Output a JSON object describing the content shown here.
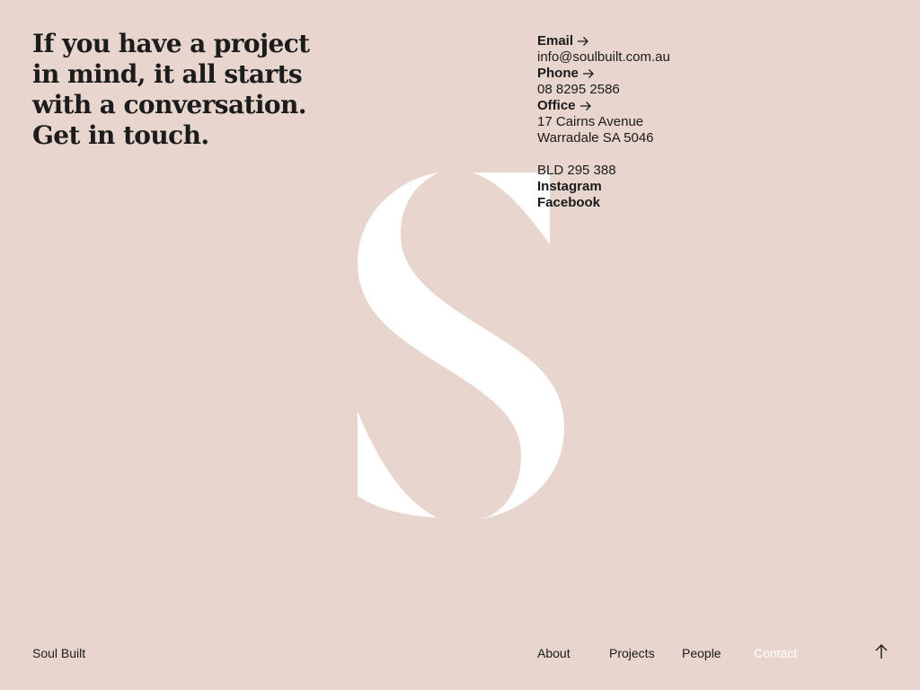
{
  "headline": "If you have a project in mind, it all starts with a conversation. Get in touch.",
  "contact": {
    "email": {
      "label": "Email",
      "value": "info@soulbuilt.com.au",
      "icon": "arrow-right-icon"
    },
    "phone": {
      "label": "Phone",
      "value": "08 8295 2586",
      "icon": "arrow-right-icon"
    },
    "office": {
      "label": "Office",
      "address_line1": "17 Cairns Avenue",
      "address_line2": "Warradale SA 5046",
      "icon": "arrow-right-icon"
    },
    "bld": "BLD 295 388",
    "social": [
      "Instagram",
      "Facebook"
    ]
  },
  "footer": {
    "brand": "Soul Built",
    "nav": [
      "About",
      "Projects",
      "People",
      "Contact"
    ],
    "active_nav": "Contact",
    "back_to_top_icon": "arrow-up-icon"
  },
  "colors": {
    "background": "#e8d6ce",
    "text": "#1a1a1a",
    "accent": "#ffffff"
  }
}
